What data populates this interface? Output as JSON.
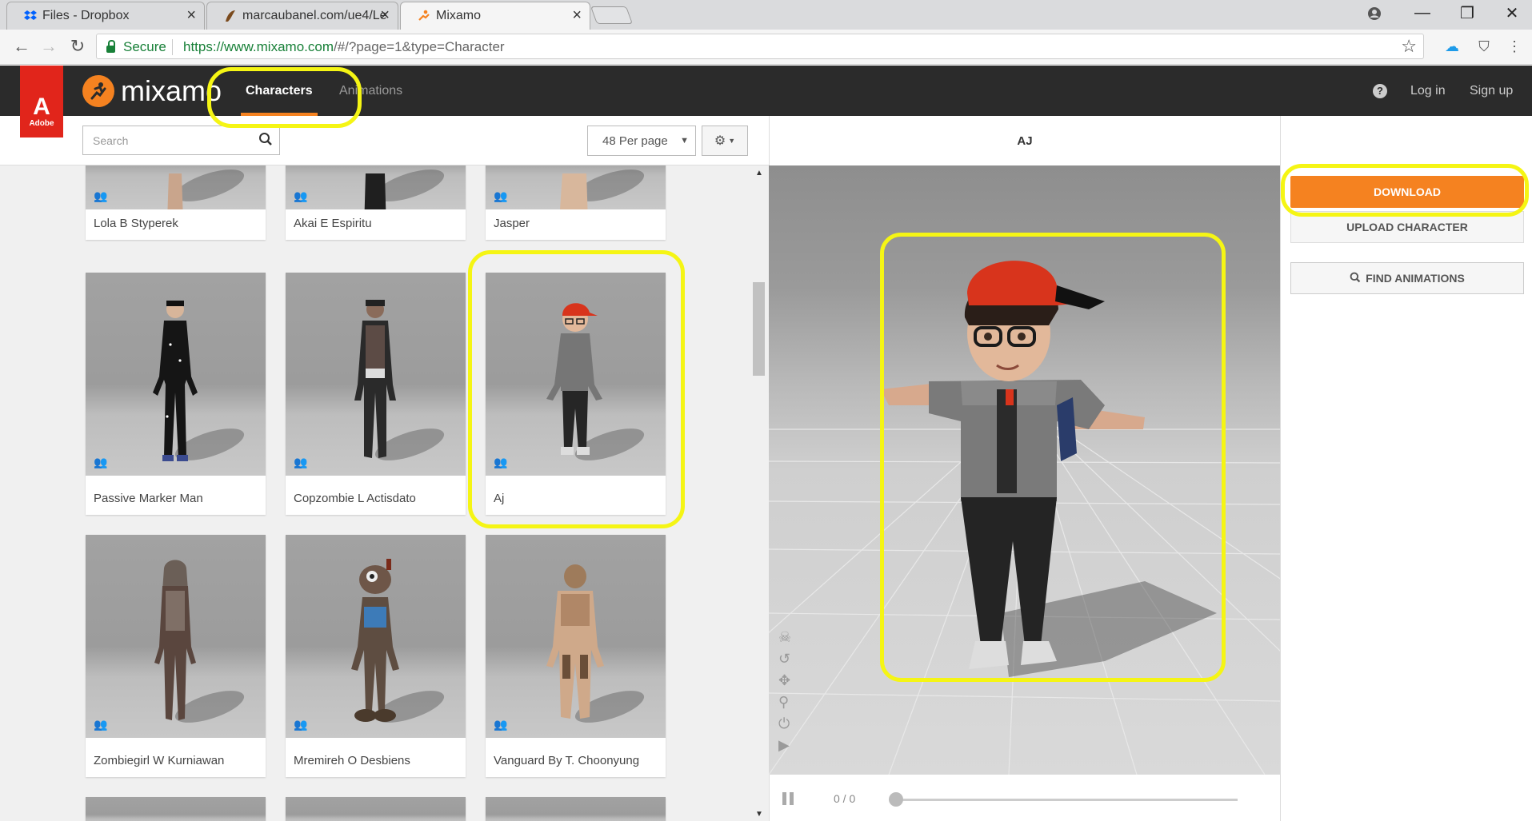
{
  "browser": {
    "tabs": [
      {
        "title": "Files - Dropbox",
        "icon": "dropbox-icon"
      },
      {
        "title": "marcaubanel.com/ue4/Le",
        "icon": "site-icon"
      },
      {
        "title": "Mixamo",
        "icon": "mixamo-icon"
      }
    ],
    "address": {
      "secure_label": "Secure",
      "url_host": "https://www.mixamo.com",
      "url_rest": "/#/?page=1&type=Character"
    }
  },
  "header": {
    "adobe_label": "Adobe",
    "logo_text": "mixamo",
    "tabs": [
      {
        "label": "Characters",
        "active": true
      },
      {
        "label": "Animations",
        "active": false
      }
    ],
    "help_icon": "?",
    "login": "Log in",
    "signup": "Sign up"
  },
  "toolbar": {
    "search_placeholder": "Search",
    "per_page": "48 Per page"
  },
  "characters": [
    {
      "name": "Lola B Styperek"
    },
    {
      "name": "Akai E Espiritu"
    },
    {
      "name": "Jasper"
    },
    {
      "name": "Passive Marker Man"
    },
    {
      "name": "Copzombie L Actisdato"
    },
    {
      "name": "Aj"
    },
    {
      "name": "Zombiegirl W Kurniawan"
    },
    {
      "name": "Mremireh O Desbiens"
    },
    {
      "name": "Vanguard By T. Choonyung"
    }
  ],
  "viewer": {
    "title": "AJ",
    "frames": "0 / 0"
  },
  "sidebar": {
    "download": "DOWNLOAD",
    "upload": "UPLOAD CHARACTER",
    "find": "FIND ANIMATIONS"
  },
  "colors": {
    "accent": "#f58220",
    "header_bg": "#2b2b2b",
    "highlight": "#f5f514",
    "adobe_red": "#e1251b"
  }
}
